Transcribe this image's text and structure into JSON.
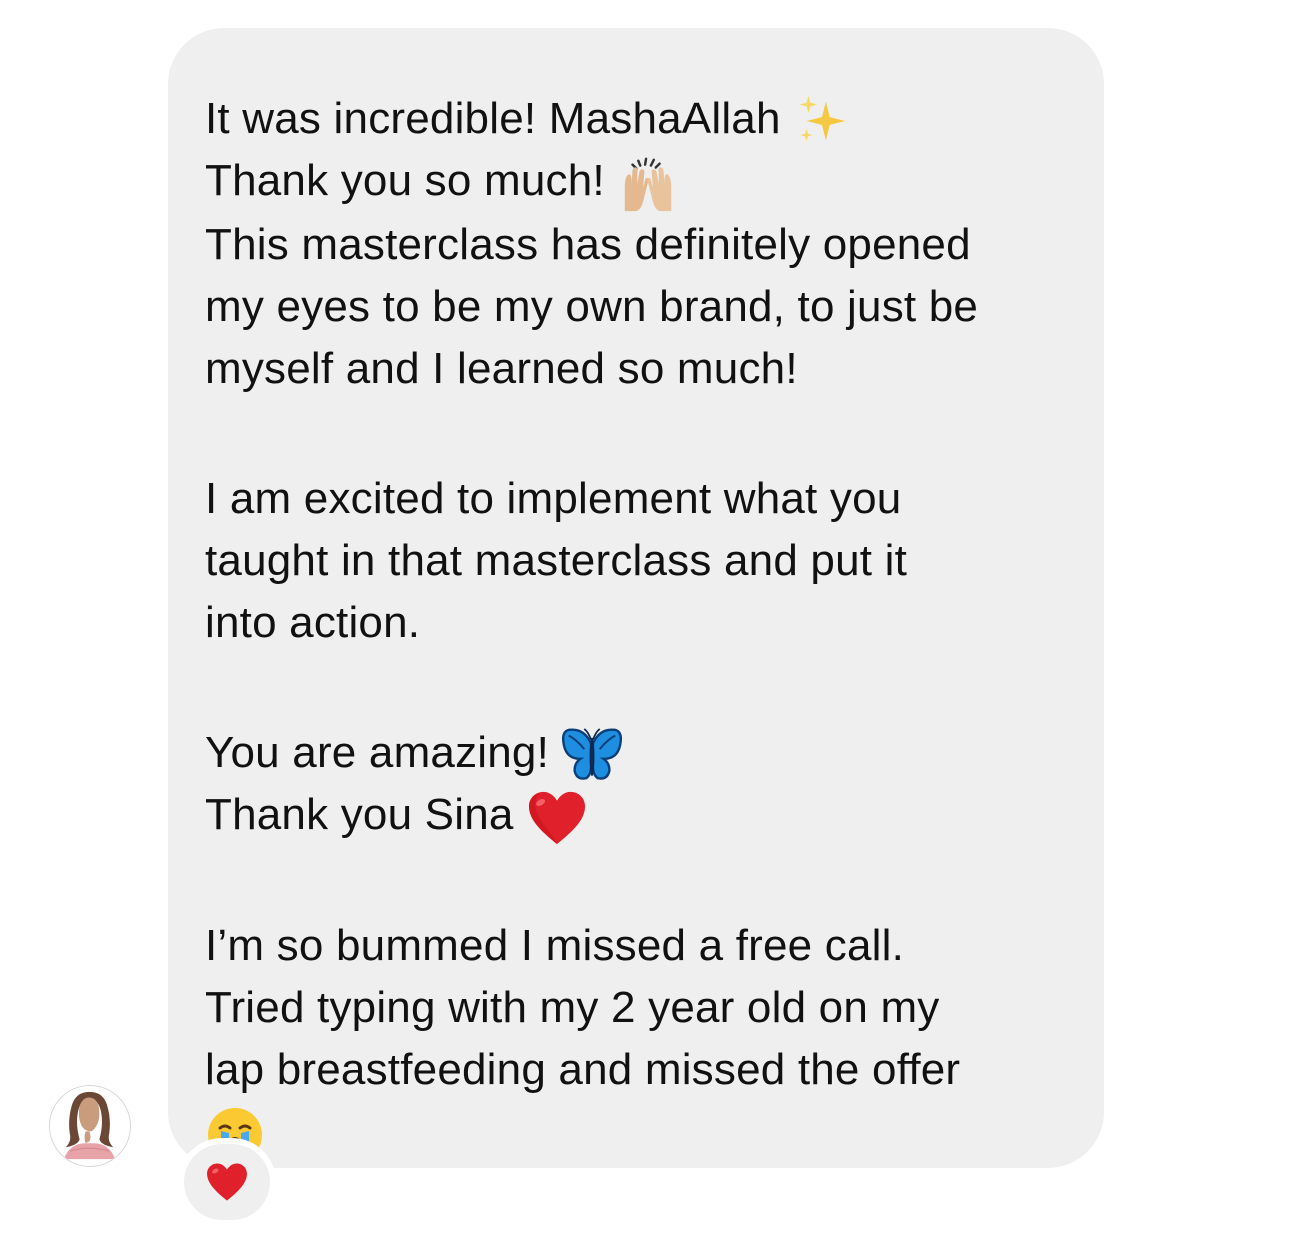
{
  "message": {
    "line1": "It was incredible! MashaAllah",
    "line2": "Thank you so much!",
    "line3": "This masterclass has definitely opened",
    "line4": "my eyes to be my own brand, to just be",
    "line5": "myself and I learned so much!",
    "line6": "I am excited to implement what you",
    "line7": "taught in that masterclass and put it",
    "line8": "into action.",
    "line9": "You are amazing!",
    "line10": "Thank you Sina",
    "line11": "I’m so bummed I missed a free call.",
    "line12": "Tried typing with my 2 year old on my",
    "line13": "lap breastfeeding and missed the offer"
  },
  "emojis": [
    "sparkles-icon",
    "raising-hands-icon",
    "butterfly-icon",
    "red-heart-icon",
    "crying-face-icon"
  ],
  "reaction": {
    "icon": "red-heart-icon"
  },
  "colors": {
    "bubble": "#efefef",
    "text": "#111111",
    "heart": "#e0202b"
  }
}
